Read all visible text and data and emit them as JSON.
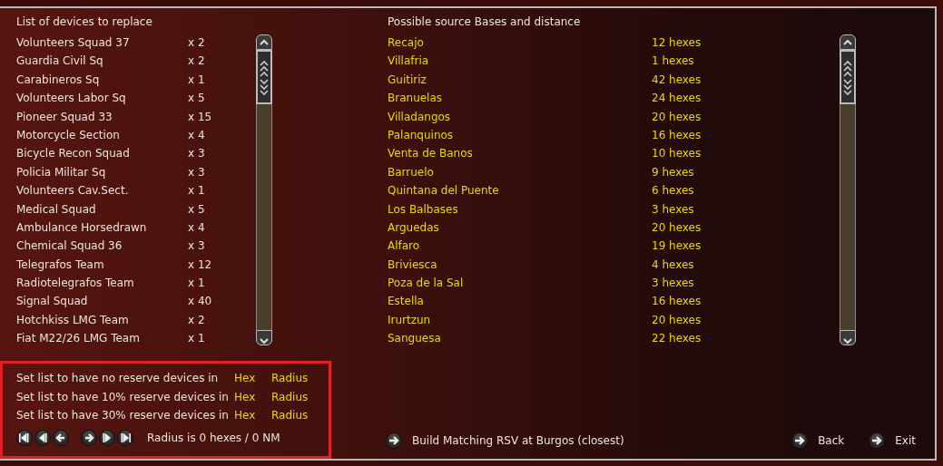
{
  "devices": {
    "title": "List of devices to replace",
    "rows": [
      {
        "name": "Volunteers Squad 37",
        "count": "x 2"
      },
      {
        "name": "Guardia Civil Sq",
        "count": "x 2"
      },
      {
        "name": "Carabineros Sq",
        "count": "x 1"
      },
      {
        "name": "Volunteers Labor Sq",
        "count": "x 5"
      },
      {
        "name": "Pioneer Squad 33",
        "count": "x 15"
      },
      {
        "name": "Motorcycle Section",
        "count": "x 4"
      },
      {
        "name": "Bicycle Recon Squad",
        "count": "x 3"
      },
      {
        "name": "Policia Militar Sq",
        "count": "x 3"
      },
      {
        "name": "Volunteers Cav.Sect.",
        "count": "x 1"
      },
      {
        "name": "Medical Squad",
        "count": "x 5"
      },
      {
        "name": "Ambulance Horsedrawn",
        "count": "x 4"
      },
      {
        "name": "Chemical Squad 36",
        "count": "x 3"
      },
      {
        "name": "Telegrafos Team",
        "count": "x 12"
      },
      {
        "name": "Radiotelegrafos Team",
        "count": "x 1"
      },
      {
        "name": "Signal Squad",
        "count": "x 40"
      },
      {
        "name": "Hotchkiss LMG Team",
        "count": "x 2"
      },
      {
        "name": "Fiat M22/26 LMG Team",
        "count": "x 1"
      }
    ]
  },
  "bases": {
    "title": "Possible source Bases and distance",
    "rows": [
      {
        "name": "Recajo",
        "distance": "12 hexes"
      },
      {
        "name": "Villafria",
        "distance": "1 hexes"
      },
      {
        "name": "Guitiriz",
        "distance": "42 hexes"
      },
      {
        "name": "Branuelas",
        "distance": "24 hexes"
      },
      {
        "name": "Villadangos",
        "distance": "20 hexes"
      },
      {
        "name": "Palanquinos",
        "distance": "16 hexes"
      },
      {
        "name": "Venta de Banos",
        "distance": "10 hexes"
      },
      {
        "name": "Barruelo",
        "distance": "9 hexes"
      },
      {
        "name": "Quintana del Puente",
        "distance": "6 hexes"
      },
      {
        "name": "Los Balbases",
        "distance": "3 hexes"
      },
      {
        "name": "Arguedas",
        "distance": "20 hexes"
      },
      {
        "name": "Alfaro",
        "distance": "19 hexes"
      },
      {
        "name": "Briviesca",
        "distance": "4 hexes"
      },
      {
        "name": "Poza de la Sal",
        "distance": "3 hexes"
      },
      {
        "name": "Estella",
        "distance": "16 hexes"
      },
      {
        "name": "Irurtzun",
        "distance": "20 hexes"
      },
      {
        "name": "Sanguesa",
        "distance": "22 hexes"
      }
    ]
  },
  "reserve_options": [
    {
      "label": "Set list to have no reserve devices in",
      "hex": "Hex",
      "radius": "Radius"
    },
    {
      "label": "Set list to have 10% reserve devices in",
      "hex": "Hex",
      "radius": "Radius"
    },
    {
      "label": "Set list to have 30% reserve devices in",
      "hex": "Hex",
      "radius": "Radius"
    }
  ],
  "radius_text": "Radius is 0 hexes / 0 NM",
  "actions": {
    "build": "Build Matching RSV at Burgos (closest)",
    "back": "Back",
    "exit": "Exit"
  }
}
